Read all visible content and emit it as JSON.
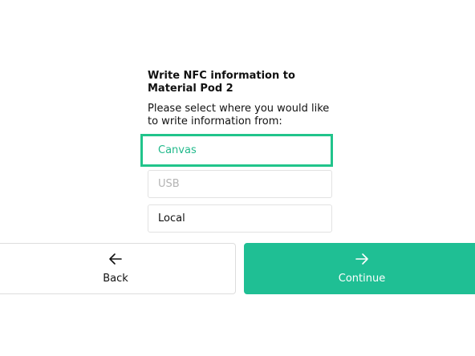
{
  "dialog": {
    "title": "Write NFC information to Material Pod 2",
    "subtitle": "Please select where you would like to write information from:"
  },
  "options": [
    {
      "label": "Canvas",
      "state": "selected"
    },
    {
      "label": "USB",
      "state": "disabled"
    },
    {
      "label": "Local",
      "state": "enabled"
    }
  ],
  "nav": {
    "back_label": "Back",
    "back_icon": "arrow-left-icon",
    "continue_label": "Continue",
    "continue_icon": "arrow-right-icon"
  },
  "colors": {
    "accent": "#1fbf94",
    "selected_border": "#21c48b",
    "disabled_text": "#b4b4b4"
  }
}
